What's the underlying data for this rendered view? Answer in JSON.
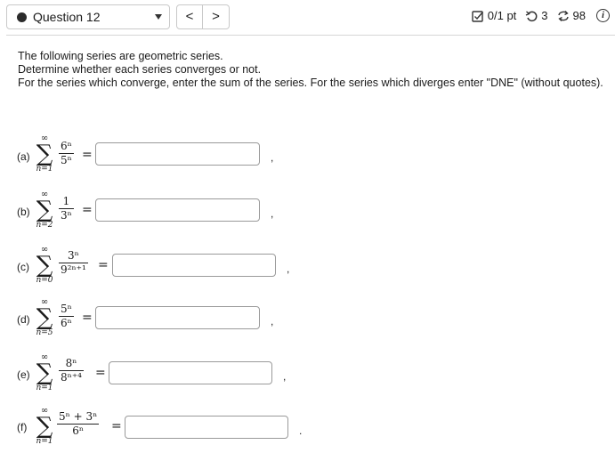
{
  "header": {
    "question_label": "Question 12",
    "nav_prev": "<",
    "nav_next": ">",
    "score": "0/1 pt",
    "retries": "3",
    "attempts": "98"
  },
  "intro": {
    "line1": "The following series are geometric series.",
    "line2": "Determine whether each series converges or not.",
    "line3": "For the series which converge, enter the sum of the series. For the series which diverges enter \"DNE\" (without quotes)."
  },
  "parts": [
    {
      "label": "(a)",
      "upper": "∞",
      "lower": "n=1",
      "numerator": "6ⁿ",
      "denominator": "5ⁿ",
      "answer": "",
      "punct": ","
    },
    {
      "label": "(b)",
      "upper": "∞",
      "lower": "n=2",
      "numerator": "1",
      "denominator": "3ⁿ",
      "answer": "",
      "punct": ","
    },
    {
      "label": "(c)",
      "upper": "∞",
      "lower": "n=0",
      "numerator": "3ⁿ",
      "denominator": "9²ⁿ⁺¹",
      "answer": "",
      "punct": ","
    },
    {
      "label": "(d)",
      "upper": "∞",
      "lower": "n=5",
      "numerator": "5ⁿ",
      "denominator": "6ⁿ",
      "answer": "",
      "punct": ","
    },
    {
      "label": "(e)",
      "upper": "∞",
      "lower": "n=1",
      "numerator": "8ⁿ",
      "denominator": "8ⁿ⁺⁴",
      "answer": "",
      "punct": ","
    },
    {
      "label": "(f)",
      "upper": "∞",
      "lower": "n=1",
      "numerator": "5ⁿ + 3ⁿ",
      "denominator": "6ⁿ",
      "answer": "",
      "punct": "."
    }
  ],
  "icons": {
    "score": "checkbox-edit-icon",
    "retries": "undo-icon",
    "attempts": "refresh-arrows-icon",
    "info": "info-icon"
  }
}
